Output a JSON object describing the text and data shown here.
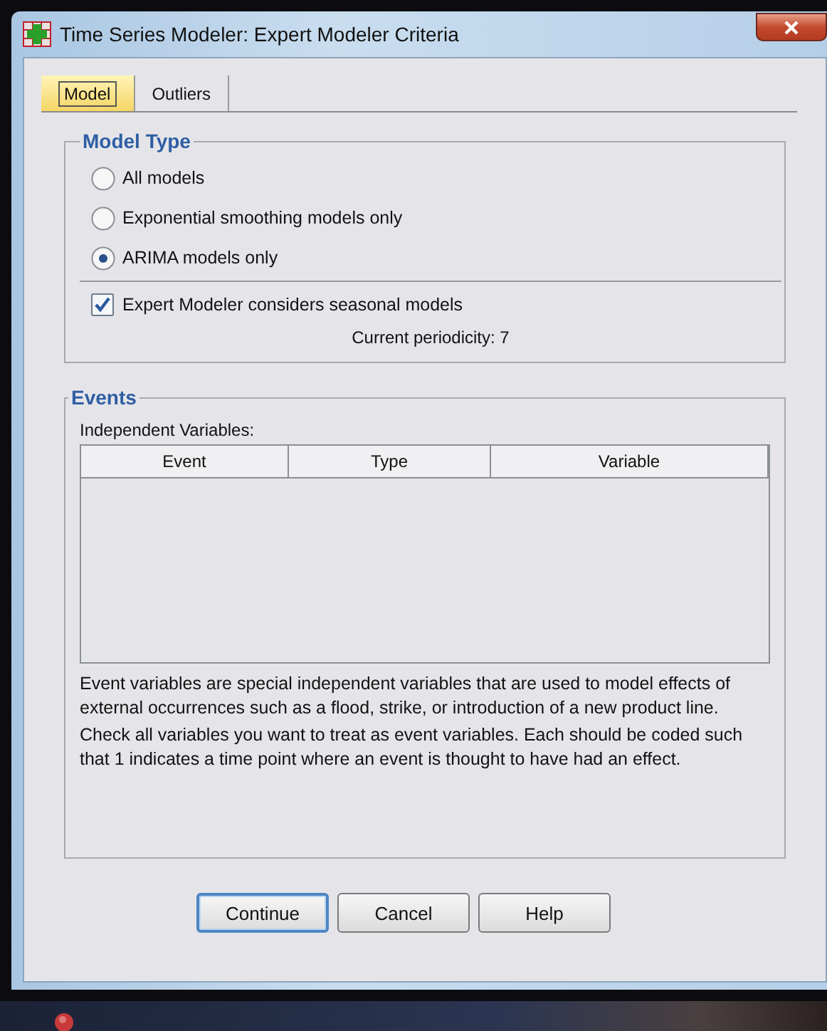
{
  "window": {
    "title": "Time Series Modeler: Expert Modeler Criteria"
  },
  "tabs": [
    {
      "label": "Model",
      "selected": true
    },
    {
      "label": "Outliers",
      "selected": false
    }
  ],
  "model_type": {
    "title": "Model Type",
    "options": [
      {
        "label": "All models",
        "selected": false
      },
      {
        "label": "Exponential smoothing models only",
        "selected": false
      },
      {
        "label": "ARIMA models only",
        "selected": true
      }
    ],
    "seasonal": {
      "label": "Expert Modeler considers seasonal models",
      "checked": true
    },
    "periodicity": "Current periodicity: 7"
  },
  "events": {
    "title": "Events",
    "list_label": "Independent Variables:",
    "table": {
      "columns": [
        "Event",
        "Type",
        "Variable"
      ]
    },
    "notes": [
      "Event variables are special independent variables that are used to model effects of external occurrences such as a flood, strike, or introduction of a new product line.",
      "Check all variables you want to treat as event variables. Each should be coded such that 1 indicates a time point where an event is thought to have had an effect."
    ]
  },
  "buttons": [
    {
      "label": "Continue",
      "default": true
    },
    {
      "label": "Cancel",
      "default": false
    },
    {
      "label": "Help",
      "default": false
    }
  ]
}
